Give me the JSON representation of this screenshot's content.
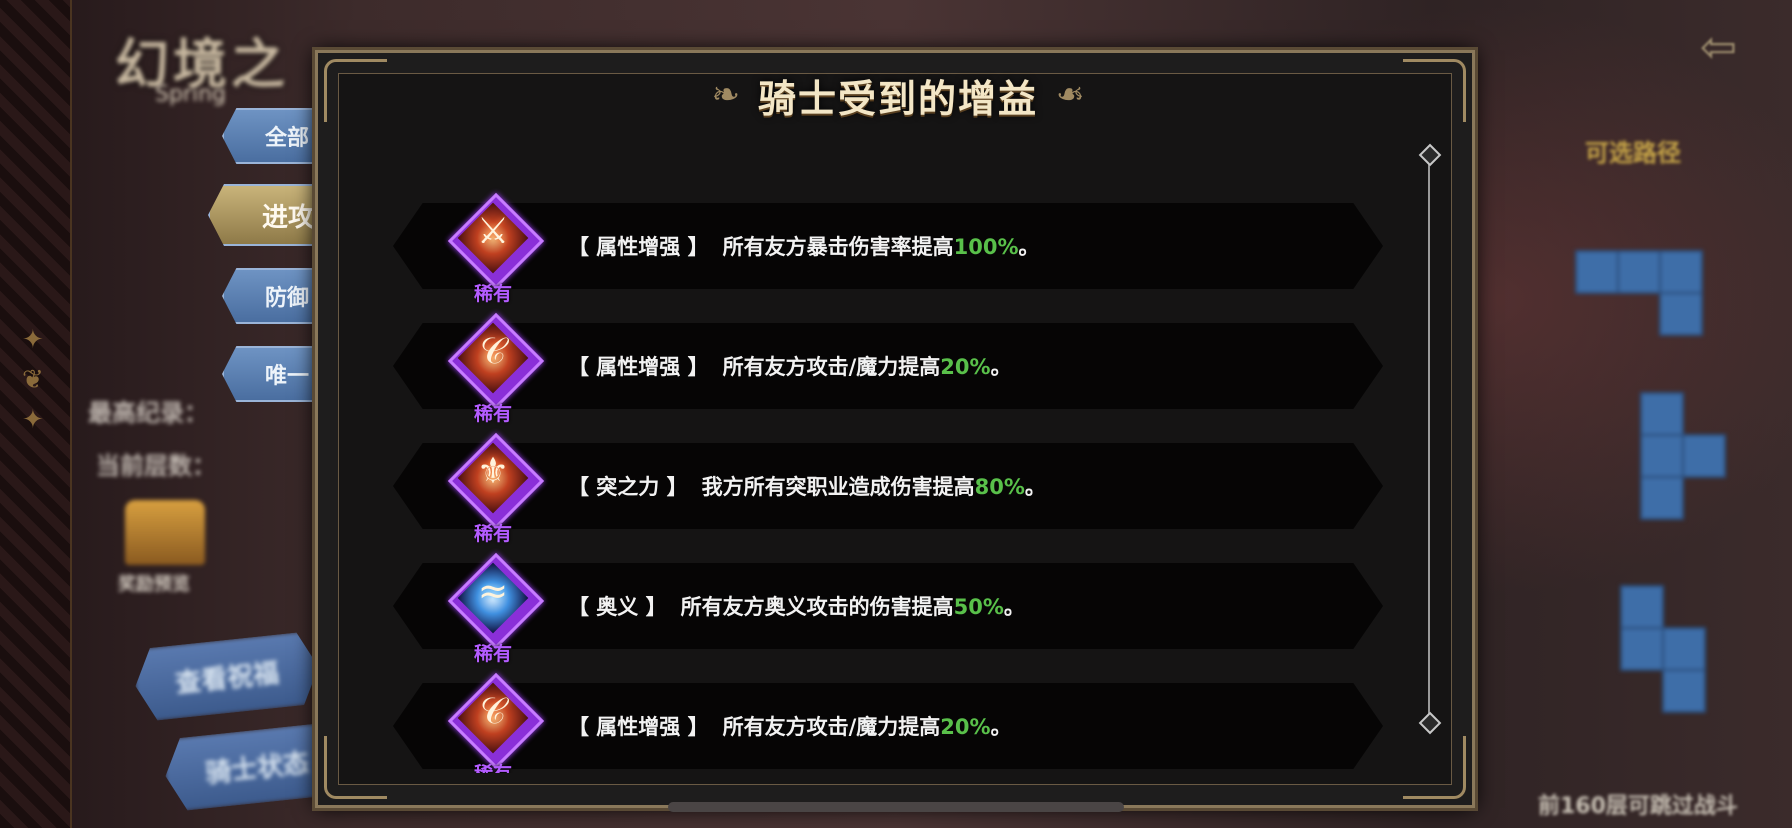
{
  "background": {
    "title": "幻境之",
    "subtitle": "Spring",
    "stat_best": "最高纪录：",
    "stat_current": "当前层数：",
    "chest_label": "奖励预览",
    "btn_blessing": "查看祝福",
    "btn_knight_status": "骑士状态",
    "path_title": "可选路径",
    "bottom_right_note": "前160层可跳过战斗"
  },
  "tabs": [
    {
      "label": "全部"
    },
    {
      "label": "进攻"
    },
    {
      "label": "防御"
    },
    {
      "label": "唯一"
    }
  ],
  "dialog": {
    "title": "骑士受到的增益"
  },
  "buffs": [
    {
      "rarity": "稀有",
      "tag": "【 属性增强 】",
      "text": "所有友方暴击伤害率提高",
      "value": "100%",
      "suffix": "。",
      "icon": "blade-icon"
    },
    {
      "rarity": "稀有",
      "tag": "【 属性增强 】",
      "text": "所有友方攻击/魔力提高",
      "value": "20%",
      "suffix": "。",
      "icon": "swirl-icon"
    },
    {
      "rarity": "稀有",
      "tag": "【 突之力 】",
      "text": "我方所有突职业造成伤害提高",
      "value": "80%",
      "suffix": "。",
      "icon": "spear-icon"
    },
    {
      "rarity": "稀有",
      "tag": "【 奥义 】",
      "text": "所有友方奥义攻击的伤害提高",
      "value": "50%",
      "suffix": "。",
      "icon": "wave-icon"
    },
    {
      "rarity": "稀有",
      "tag": "【 属性增强 】",
      "text": "所有友方攻击/魔力提高",
      "value": "20%",
      "suffix": "。",
      "icon": "swirl-icon"
    }
  ],
  "colors": {
    "rarity": "#b45cff",
    "value_green": "#59c04a",
    "title_gold": "#f3e6c6"
  }
}
